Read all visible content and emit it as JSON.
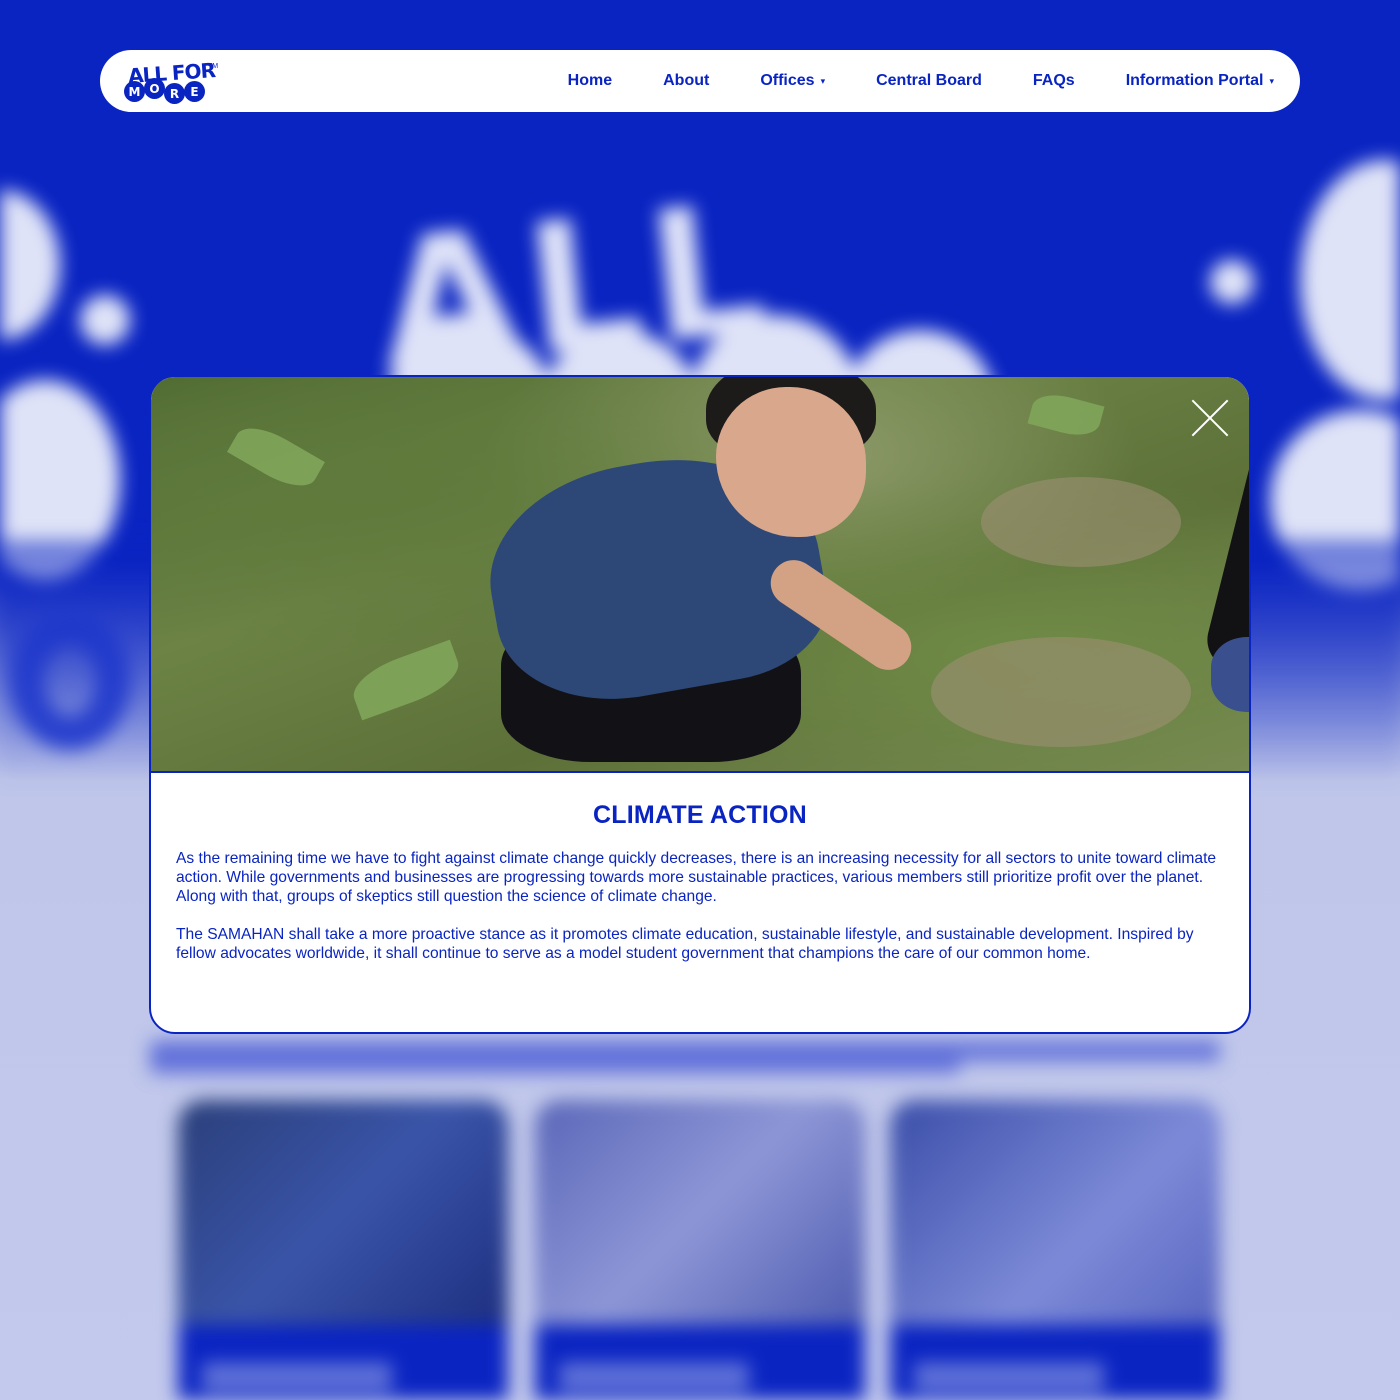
{
  "colors": {
    "brand_blue": "#0a24c2",
    "background_light": "#c3c9ec",
    "white": "#ffffff"
  },
  "header": {
    "logo": {
      "line1": "ALL FOR",
      "line2_letters": [
        "M",
        "O",
        "R",
        "E"
      ],
      "trademark": "TM"
    },
    "nav": [
      {
        "label": "Home",
        "has_dropdown": false
      },
      {
        "label": "About",
        "has_dropdown": false
      },
      {
        "label": "Offices",
        "has_dropdown": true,
        "caret": "▾"
      },
      {
        "label": "Central Board",
        "has_dropdown": false
      },
      {
        "label": "FAQs",
        "has_dropdown": false
      },
      {
        "label": "Information Portal",
        "has_dropdown": true,
        "caret": "▾"
      }
    ]
  },
  "background": {
    "hero_text": "ALL FOR"
  },
  "modal": {
    "image_icon": "tree-planting-photo",
    "close_icon": "close-x-icon",
    "title": "CLIMATE ACTION",
    "paragraphs": [
      "As the remaining time we have to fight against climate change quickly decreases, there is an increasing necessity for all sectors to unite toward climate action. While governments and businesses are progressing towards more sustainable practices, various members still prioritize profit over the planet. Along with that, groups of skeptics still question the science of climate change.",
      "The SAMAHAN shall take a more proactive stance as it promotes climate education, sustainable lifestyle, and sustainable development. Inspired by fellow advocates worldwide, it shall continue to serve as a model student government that champions the care of our common home."
    ]
  }
}
